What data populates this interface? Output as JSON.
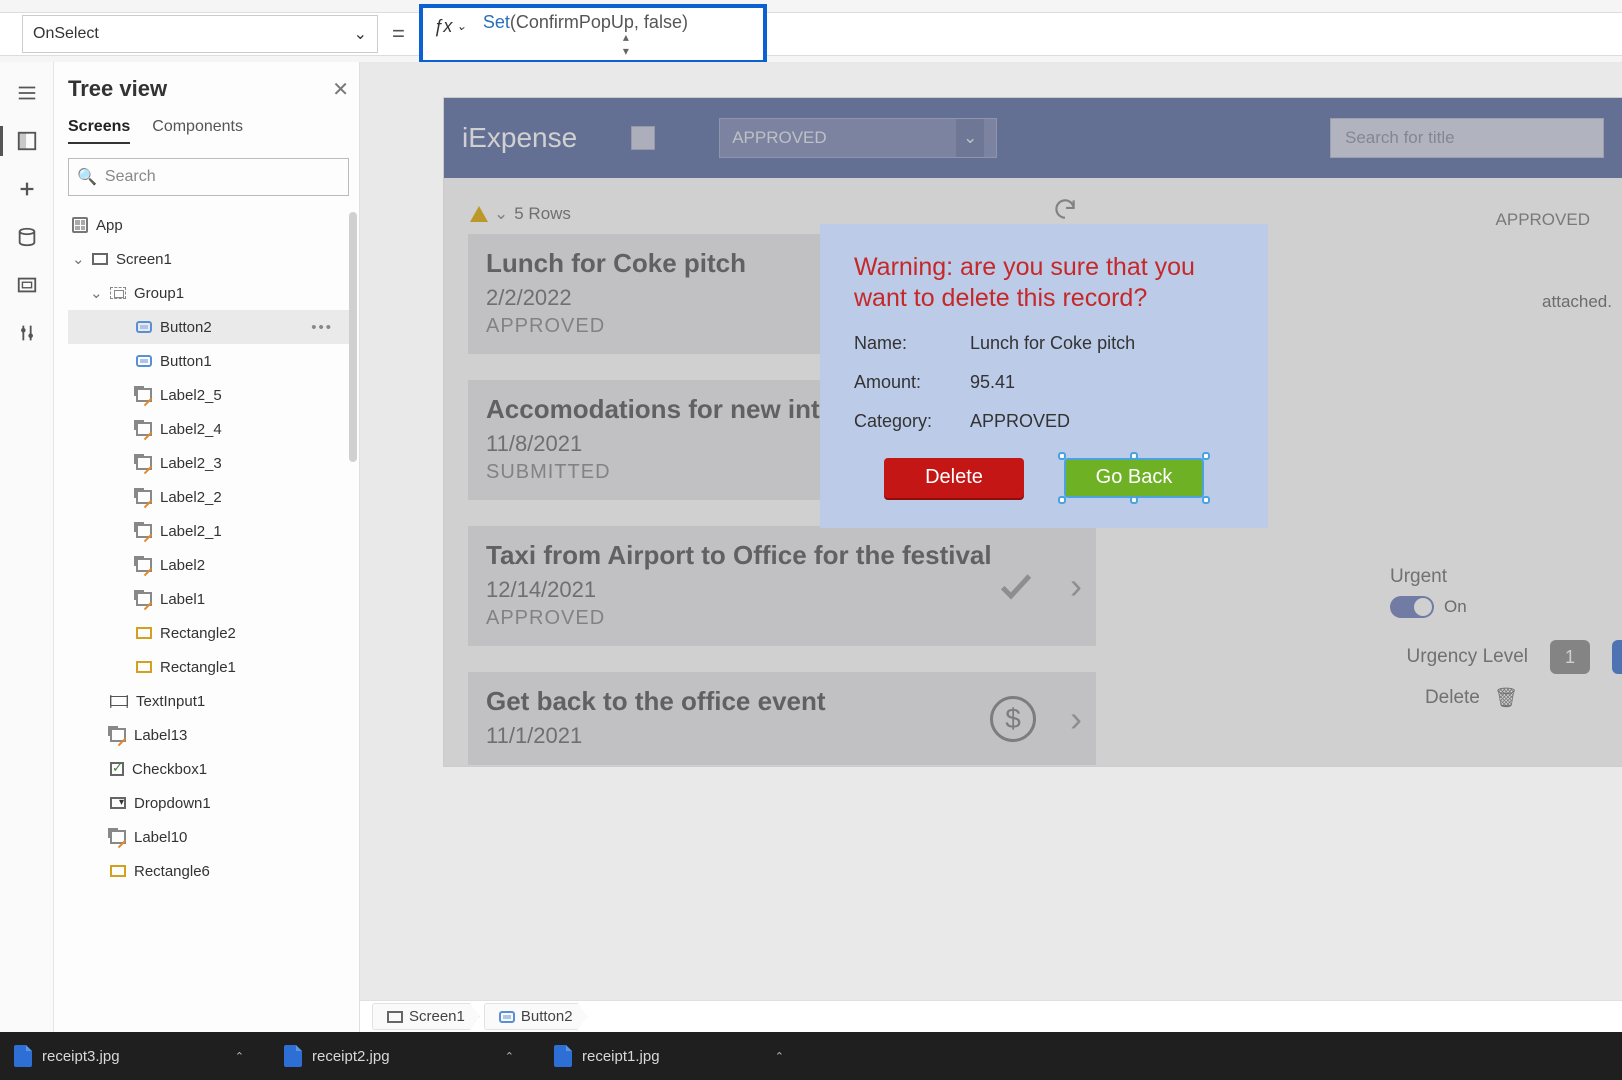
{
  "property_selector": "OnSelect",
  "formula": {
    "func": "Set",
    "args": "(ConfirmPopUp, false)"
  },
  "tree": {
    "title": "Tree view",
    "tabs": [
      "Screens",
      "Components"
    ],
    "active_tab": "Screens",
    "search_placeholder": "Search",
    "items": [
      {
        "label": "App",
        "icon": "app",
        "indent": 0
      },
      {
        "label": "Screen1",
        "icon": "screen",
        "indent": 0,
        "chev": true
      },
      {
        "label": "Group1",
        "icon": "group",
        "indent": 1,
        "chev": true
      },
      {
        "label": "Button2",
        "icon": "btn",
        "indent": 2,
        "selected": true,
        "more": true
      },
      {
        "label": "Button1",
        "icon": "btn",
        "indent": 2
      },
      {
        "label": "Label2_5",
        "icon": "label",
        "indent": 2
      },
      {
        "label": "Label2_4",
        "icon": "label",
        "indent": 2
      },
      {
        "label": "Label2_3",
        "icon": "label",
        "indent": 2
      },
      {
        "label": "Label2_2",
        "icon": "label",
        "indent": 2
      },
      {
        "label": "Label2_1",
        "icon": "label",
        "indent": 2
      },
      {
        "label": "Label2",
        "icon": "label",
        "indent": 2
      },
      {
        "label": "Label1",
        "icon": "label",
        "indent": 2
      },
      {
        "label": "Rectangle2",
        "icon": "rect",
        "indent": 2
      },
      {
        "label": "Rectangle1",
        "icon": "rect",
        "indent": 2
      },
      {
        "label": "TextInput1",
        "icon": "txtin",
        "indent": 1
      },
      {
        "label": "Label13",
        "icon": "label",
        "indent": 1
      },
      {
        "label": "Checkbox1",
        "icon": "chk",
        "indent": 1
      },
      {
        "label": "Dropdown1",
        "icon": "dd",
        "indent": 1
      },
      {
        "label": "Label10",
        "icon": "label",
        "indent": 1
      },
      {
        "label": "Rectangle6",
        "icon": "rect",
        "indent": 1
      }
    ]
  },
  "app": {
    "title": "iExpense",
    "dropdown_value": "APPROVED",
    "search_placeholder": "Search for title",
    "rows_label": "5 Rows",
    "cards": [
      {
        "title": "Lunch for Coke pitch",
        "date": "2/2/2022",
        "status": "APPROVED"
      },
      {
        "title": "Accomodations for new interv",
        "date": "11/8/2021",
        "status": "SUBMITTED"
      },
      {
        "title": "Taxi from Airport to Office for the festival",
        "date": "12/14/2021",
        "status": "APPROVED",
        "check": true
      },
      {
        "title": "Get back to the office event",
        "date": "11/1/2021",
        "dollar": true
      }
    ],
    "details": {
      "approved": "APPROVED",
      "attached": "attached.",
      "urgent_label": "Urgent",
      "urgent_value": "On",
      "urgency_label": "Urgency Level",
      "urgency_value": "1",
      "delete_label": "Delete"
    }
  },
  "popup": {
    "warning": "Warning: are you sure that you want to delete this record?",
    "fields": [
      {
        "lbl": "Name:",
        "val": "Lunch for Coke pitch"
      },
      {
        "lbl": "Amount:",
        "val": "95.41"
      },
      {
        "lbl": "Category:",
        "val": "APPROVED"
      }
    ],
    "delete_btn": "Delete",
    "back_btn": "Go Back"
  },
  "breadcrumb": [
    {
      "label": "Screen1",
      "icon": "screen"
    },
    {
      "label": "Button2",
      "icon": "btn"
    }
  ],
  "taskbar": [
    "receipt3.jpg",
    "receipt2.jpg",
    "receipt1.jpg"
  ]
}
